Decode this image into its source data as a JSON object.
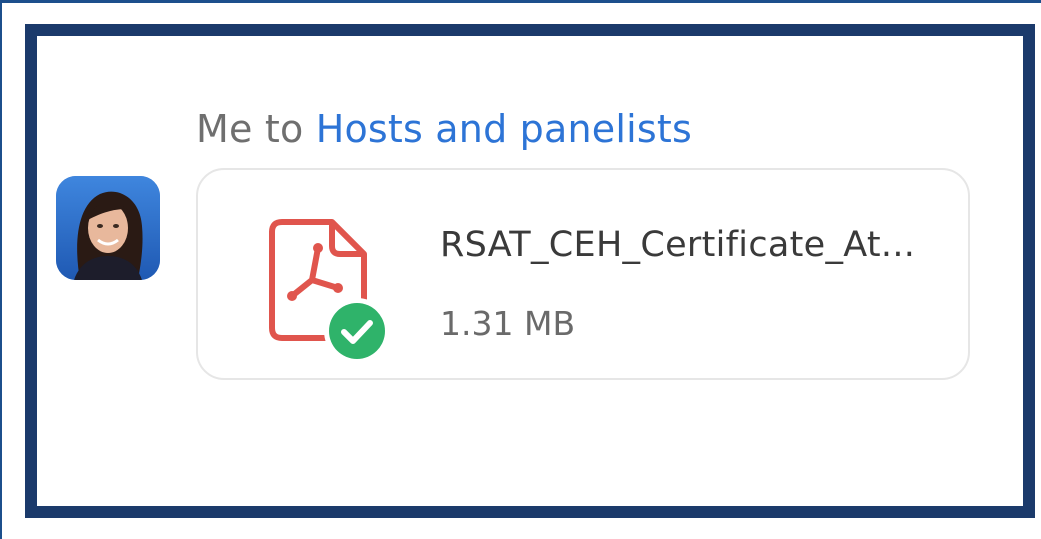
{
  "message": {
    "sender": "Me",
    "connector": "to",
    "recipient": "Hosts and panelists"
  },
  "attachment": {
    "file_name": "RSAT_CEH_Certificate_At...",
    "file_size": "1.31 MB",
    "file_type_icon": "pdf-file-icon",
    "status_icon": "check-circle-icon"
  },
  "colors": {
    "frame": "#1b3a6b",
    "recipient_link": "#2d74d6",
    "pdf_red": "#e0554d",
    "success_green": "#2fb36a"
  }
}
